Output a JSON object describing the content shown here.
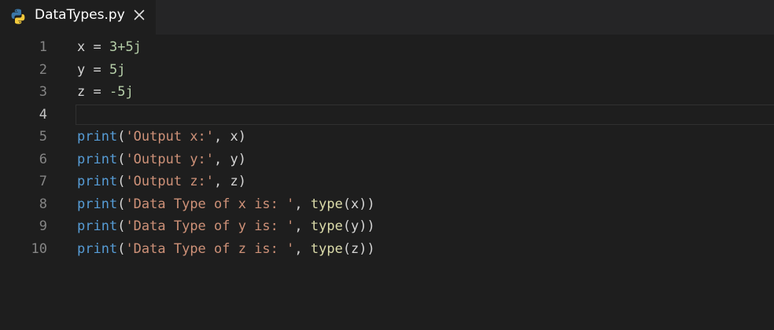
{
  "tab": {
    "title": "DataTypes.py",
    "icon": "python-icon",
    "close_icon": "close-icon"
  },
  "colors": {
    "background": "#1e1e1e",
    "tabbar": "#252526",
    "line_number": "#858585",
    "keyword_print": "#569cd6",
    "builtin_type": "#dcdcaa",
    "string": "#ce9178",
    "number": "#b5cea8",
    "text": "#d4d4d4"
  },
  "editor": {
    "active_line": 4,
    "lines": [
      {
        "num": "1",
        "tokens": [
          {
            "t": "x",
            "c": "var"
          },
          {
            "t": " = ",
            "c": "op"
          },
          {
            "t": "3+5j",
            "c": "num"
          }
        ]
      },
      {
        "num": "2",
        "tokens": [
          {
            "t": "y",
            "c": "var"
          },
          {
            "t": " = ",
            "c": "op"
          },
          {
            "t": "5j",
            "c": "num"
          }
        ]
      },
      {
        "num": "3",
        "tokens": [
          {
            "t": "z",
            "c": "var"
          },
          {
            "t": " = ",
            "c": "op"
          },
          {
            "t": "-5j",
            "c": "num"
          }
        ]
      },
      {
        "num": "4",
        "tokens": []
      },
      {
        "num": "5",
        "tokens": [
          {
            "t": "print",
            "c": "fn"
          },
          {
            "t": "(",
            "c": "pun"
          },
          {
            "t": "'Output x:'",
            "c": "str"
          },
          {
            "t": ", x)",
            "c": "pun"
          }
        ]
      },
      {
        "num": "6",
        "tokens": [
          {
            "t": "print",
            "c": "fn"
          },
          {
            "t": "(",
            "c": "pun"
          },
          {
            "t": "'Output y:'",
            "c": "str"
          },
          {
            "t": ", y)",
            "c": "pun"
          }
        ]
      },
      {
        "num": "7",
        "tokens": [
          {
            "t": "print",
            "c": "fn"
          },
          {
            "t": "(",
            "c": "pun"
          },
          {
            "t": "'Output z:'",
            "c": "str"
          },
          {
            "t": ", z)",
            "c": "pun"
          }
        ]
      },
      {
        "num": "8",
        "tokens": [
          {
            "t": "print",
            "c": "fn"
          },
          {
            "t": "(",
            "c": "pun"
          },
          {
            "t": "'Data Type of x is: '",
            "c": "str"
          },
          {
            "t": ", ",
            "c": "pun"
          },
          {
            "t": "type",
            "c": "bi"
          },
          {
            "t": "(x))",
            "c": "pun"
          }
        ]
      },
      {
        "num": "9",
        "tokens": [
          {
            "t": "print",
            "c": "fn"
          },
          {
            "t": "(",
            "c": "pun"
          },
          {
            "t": "'Data Type of y is: '",
            "c": "str"
          },
          {
            "t": ", ",
            "c": "pun"
          },
          {
            "t": "type",
            "c": "bi"
          },
          {
            "t": "(y))",
            "c": "pun"
          }
        ]
      },
      {
        "num": "10",
        "tokens": [
          {
            "t": "print",
            "c": "fn"
          },
          {
            "t": "(",
            "c": "pun"
          },
          {
            "t": "'Data Type of z is: '",
            "c": "str"
          },
          {
            "t": ", ",
            "c": "pun"
          },
          {
            "t": "type",
            "c": "bi"
          },
          {
            "t": "(z))",
            "c": "pun"
          }
        ]
      }
    ]
  }
}
